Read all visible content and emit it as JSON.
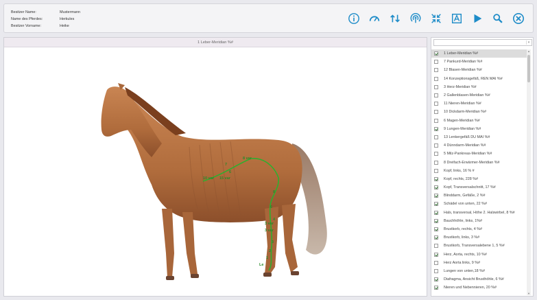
{
  "header": {
    "owner_name_label": "Besitzer Name:",
    "owner_name_value": "Mustermann",
    "horse_name_label": "Name des Pferdes:",
    "horse_name_value": "Herkules",
    "owner_first_label": "Besitzer Vorname:",
    "owner_first_value": "Heike"
  },
  "toolbar": {
    "icons": [
      "info-icon",
      "gauge-icon",
      "swap-icon",
      "broadcast-icon",
      "compress-icon",
      "image-icon",
      "play-icon",
      "search-icon",
      "close-icon"
    ],
    "accent": "#1e8cc8"
  },
  "main": {
    "title": "1 Leber-Meridian %#",
    "labels": [
      "8 var",
      "7",
      "6",
      "10 var",
      "15 var",
      "8",
      "6",
      "4",
      "3 var",
      "3 var",
      "3",
      "2",
      "1",
      "Le"
    ]
  },
  "sidebar": {
    "dropdown_value": "",
    "items": [
      {
        "label": "1 Leber-Meridian %#",
        "checked": true,
        "selected": true
      },
      {
        "label": "7 Pankurd-Meridian %#",
        "checked": false
      },
      {
        "label": "12 Blasen-Meridian %#",
        "checked": false
      },
      {
        "label": "14 Konzeptionsgefäß, REN MAI %#",
        "checked": false
      },
      {
        "label": "3 Herz-Meridian %#",
        "checked": false
      },
      {
        "label": "2 Gallenblasen-Meridian %#",
        "checked": false
      },
      {
        "label": "11 Nieren-Meridian %#",
        "checked": false
      },
      {
        "label": "10 Dickdarm-Meridian %#",
        "checked": false
      },
      {
        "label": "6 Magen-Meridian %#",
        "checked": false
      },
      {
        "label": "9 Lungen-Meridian %#",
        "checked": true
      },
      {
        "label": "13 Lenkergefäß DU MAI %#",
        "checked": false
      },
      {
        "label": "4 Dünndarm-Meridian %#",
        "checked": false
      },
      {
        "label": "5 Milz-Pankreas-Meridian %#",
        "checked": false
      },
      {
        "label": "8 Dreifach-Erwärmer-Meridian %#",
        "checked": false
      },
      {
        "label": "Kopf, links, 16 % #",
        "checked": false
      },
      {
        "label": "Kopf, rechts, 228 %#",
        "checked": true
      },
      {
        "label": "Kopf, Transversalschnitt, 17 %#",
        "checked": true
      },
      {
        "label": "Blinddarm, Gefäße, 2 %#",
        "checked": true
      },
      {
        "label": "Schädel von unten, 22 %#",
        "checked": true
      },
      {
        "label": "Hals, transversal, Höhe 2. Halswirbel, 8 %#",
        "checked": true
      },
      {
        "label": "Bauchhöhle, links, 1%#",
        "checked": true
      },
      {
        "label": "Brustkorb, rechts, 4 %#",
        "checked": true
      },
      {
        "label": "Brustkorb, links, 3 %#",
        "checked": true
      },
      {
        "label": "Brustkorb, Transversalebene 1, 5 %#",
        "checked": false
      },
      {
        "label": "Herz, Aorta, rechts, 10 %#",
        "checked": true
      },
      {
        "label": "Herz Aorta links, 9 %#",
        "checked": false
      },
      {
        "label": "Lungen von unten,18 %#",
        "checked": false
      },
      {
        "label": "Diafragma, Ansicht Brusthöhle, 6 %#",
        "checked": true
      },
      {
        "label": "Nieren und Nebennieren, 20 %#",
        "checked": true
      }
    ]
  }
}
